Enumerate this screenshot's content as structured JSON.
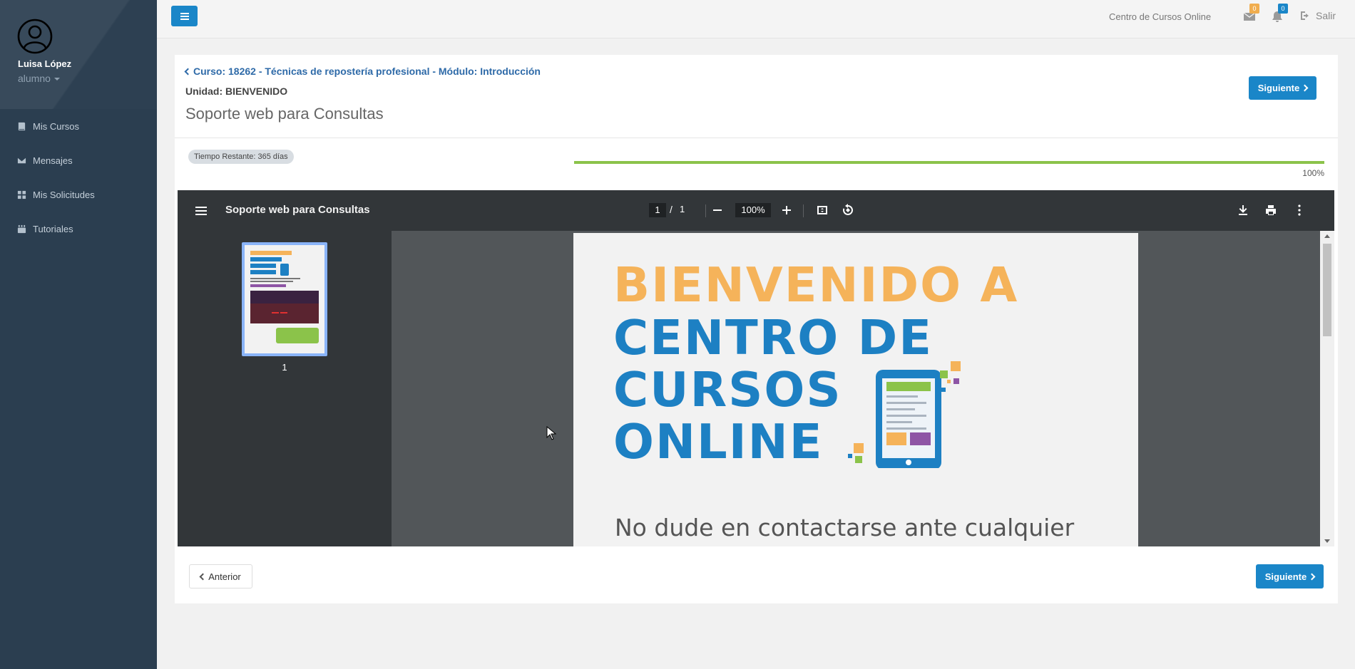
{
  "sidebar": {
    "user_name": "Luisa López",
    "user_role": "alumno",
    "items": [
      {
        "label": "Mis Cursos",
        "icon": "book-icon"
      },
      {
        "label": "Mensajes",
        "icon": "envelope-icon"
      },
      {
        "label": "Mis Solicitudes",
        "icon": "grid-icon"
      },
      {
        "label": "Tutoriales",
        "icon": "youtube-icon"
      }
    ]
  },
  "topbar": {
    "site_name": "Centro de Cursos Online",
    "messages_count": "0",
    "notifications_count": "0",
    "logout_label": "Salir",
    "colors": {
      "primary": "#1a86c8",
      "messages_badge": "#f0ad4e",
      "notifications_badge": "#1a86c8"
    }
  },
  "content": {
    "breadcrumb": "Curso: 18262 - Técnicas de repostería profesional - Módulo: Introducción",
    "unit": "Unidad: BIENVENIDO",
    "title": "Soporte web para Consultas",
    "next_label_top": "Siguiente",
    "time_remaining": "Tiempo Restante: 365 días",
    "progress_percent": 100,
    "progress_label": "100%",
    "prev_label": "Anterior",
    "next_label_bottom": "Siguiente"
  },
  "pdf": {
    "title": "Soporte web para Consultas",
    "current_page": "1",
    "total_pages": "1",
    "zoom": "100%",
    "thumb_label": "1",
    "doc_lines": [
      {
        "text": "BIENVENIDO A",
        "color": "#f5b35a"
      },
      {
        "text": "CENTRO DE",
        "color": "#1d80c3"
      },
      {
        "text": "CURSOS",
        "color": "#1d80c3"
      },
      {
        "text": "ONLINE",
        "color": "#1d80c3"
      }
    ],
    "doc_subtitle": "No dude en contactarse ante cualquier"
  }
}
